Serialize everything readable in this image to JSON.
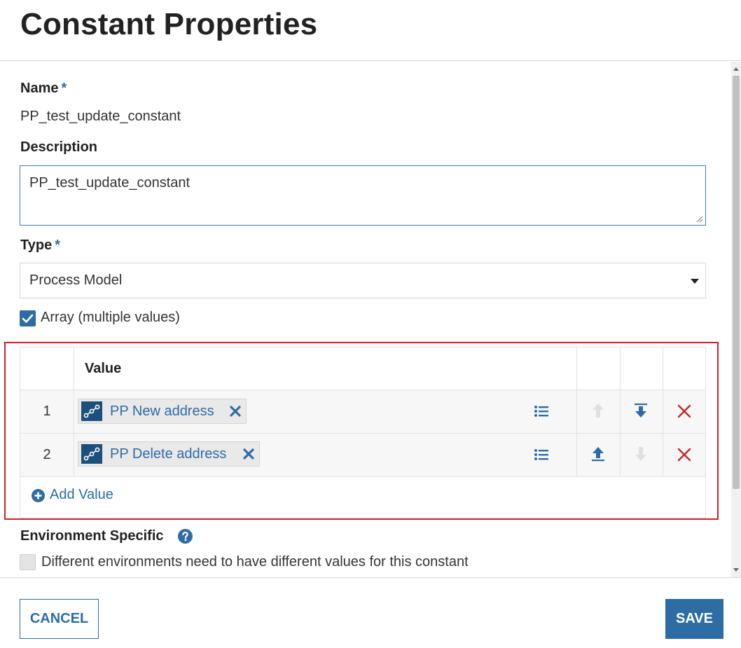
{
  "dialog": {
    "title": "Constant Properties"
  },
  "form": {
    "name_label": "Name",
    "required_marker": "*",
    "name_value": "PP_test_update_constant",
    "description_label": "Description",
    "description_value": "PP_test_update_constant",
    "type_label": "Type",
    "type_value": "Process Model",
    "array_checked": true,
    "array_label": "Array (multiple values)",
    "values_grid": {
      "column_header": "Value",
      "rows": [
        {
          "index": "1",
          "value": "PP New address",
          "icon": "process-model-icon",
          "can_move_up": false,
          "can_move_down": true
        },
        {
          "index": "2",
          "value": "PP Delete address",
          "icon": "process-model-icon",
          "can_move_up": true,
          "can_move_down": false
        }
      ],
      "add_value_label": "Add Value"
    },
    "environment_label": "Environment Specific",
    "environment_checked": false,
    "environment_checkbox_label": "Different environments need to have different values for this constant"
  },
  "footer": {
    "cancel_label": "CANCEL",
    "save_label": "SAVE"
  },
  "colors": {
    "accent": "#2e6ca4",
    "highlight": "#d0202a",
    "delete": "#c0282f",
    "disabled": "#d9d9d9"
  }
}
